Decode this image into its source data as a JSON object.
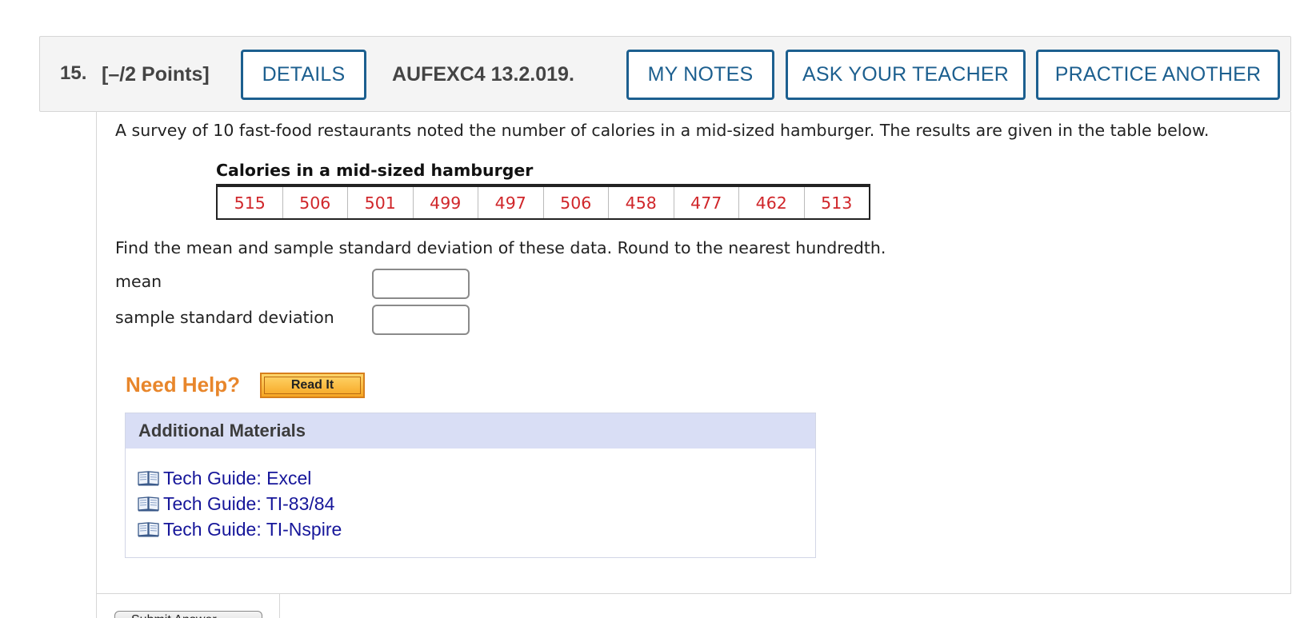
{
  "header": {
    "number": "15.",
    "points": "[–/2 Points]",
    "details_label": "DETAILS",
    "code": "AUFEXC4 13.2.019.",
    "notes_label": "MY NOTES",
    "ask_label": "ASK YOUR TEACHER",
    "practice_label": "PRACTICE ANOTHER"
  },
  "question": {
    "prompt": "A survey of 10 fast-food restaurants noted the number of calories in a mid-sized hamburger. The results are given in the table below.",
    "table_title": "Calories in a mid-sized hamburger",
    "table_values": [
      "515",
      "506",
      "501",
      "499",
      "497",
      "506",
      "458",
      "477",
      "462",
      "513"
    ],
    "instruction": "Find the mean and sample standard deviation of these data. Round to the nearest hundredth.",
    "mean_label": "mean",
    "sd_label": "sample standard deviation",
    "mean_value": "",
    "sd_value": ""
  },
  "help": {
    "need_help": "Need Help?",
    "read_it": "Read It"
  },
  "materials": {
    "heading": "Additional Materials",
    "items": [
      {
        "label": "Tech Guide: Excel",
        "icon": "book-icon"
      },
      {
        "label": "Tech Guide: TI-83/84",
        "icon": "book-icon"
      },
      {
        "label": "Tech Guide: TI-Nspire",
        "icon": "book-icon"
      }
    ]
  },
  "footer": {
    "submit_label": "Submit Answer"
  },
  "colors": {
    "accent_blue": "#1c5f8f",
    "value_red": "#d0262a",
    "help_orange": "#e8862b",
    "link_blue": "#16169a",
    "materials_header": "#d9def5"
  }
}
